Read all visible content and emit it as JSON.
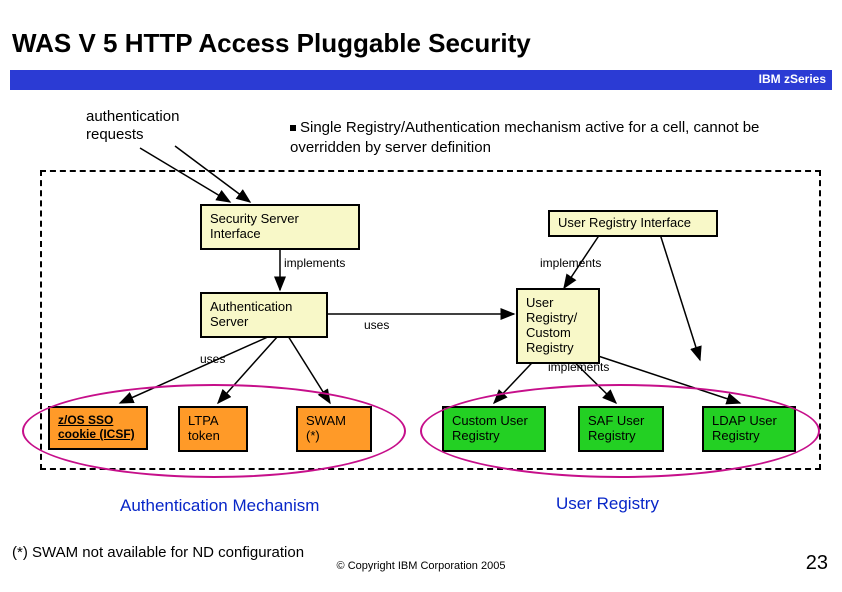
{
  "title": "WAS V 5 HTTP Access Pluggable Security",
  "brand": "IBM zSeries",
  "auth_label_line1": "authentication",
  "auth_label_line2": "requests",
  "bullet": "Single Registry/Authentication mechanism active for a cell, cannot be overridden by server definition",
  "boxes": {
    "sec_server_iface": "Security Server Interface",
    "user_reg_iface": "User Registry Interface",
    "auth_server": "Authentication Server",
    "user_reg_custom": "User Registry/ Custom Registry",
    "zos": "z/OS SSO cookie (ICSF)",
    "ltpa": "LTPA token",
    "swam": "SWAM (*)",
    "custom_ur": "Custom User Registry",
    "saf": "SAF User Registry",
    "ldap": "LDAP User Registry"
  },
  "labels": {
    "implements": "implements",
    "uses": "uses"
  },
  "sections": {
    "auth_mech": "Authentication Mechanism",
    "user_reg": "User Registry"
  },
  "footnote": "(*) SWAM not available for ND configuration",
  "copyright": "© Copyright IBM Corporation 2005",
  "page_number": "23"
}
